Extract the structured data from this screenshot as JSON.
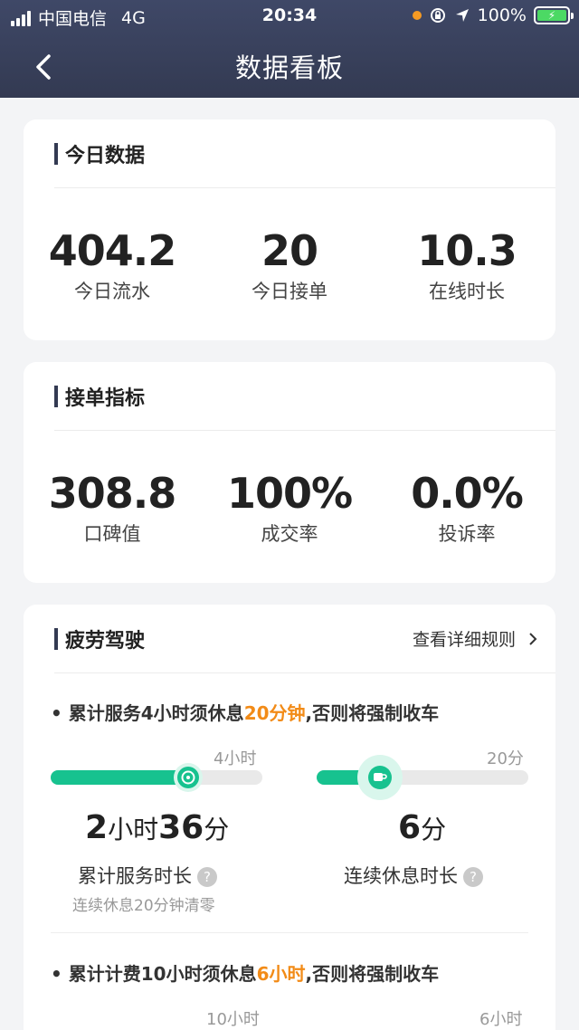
{
  "status_bar": {
    "carrier": "中国电信",
    "network": "4G",
    "time": "20:34",
    "battery": "100%",
    "accent_orange": "#f59a23",
    "battery_green": "#4cd964"
  },
  "nav": {
    "title": "数据看板",
    "back_icon": "chevron-left-icon"
  },
  "today": {
    "title": "今日数据",
    "stats": [
      {
        "value": "404.2",
        "label": "今日流水"
      },
      {
        "value": "20",
        "label": "今日接单"
      },
      {
        "value": "10.3",
        "label": "在线时长"
      }
    ]
  },
  "orders": {
    "title": "接单指标",
    "stats": [
      {
        "value": "308.8",
        "label": "口碑值"
      },
      {
        "value": "100%",
        "label": "成交率"
      },
      {
        "value": "0.0%",
        "label": "投诉率"
      }
    ]
  },
  "fatigue": {
    "title": "疲劳驾驶",
    "more_label": "查看详细规则",
    "rule1": {
      "bullet": "•",
      "prefix": "累计服务4小时须休息",
      "highlight": "20分钟",
      "suffix": ",否则将强制收车"
    },
    "service": {
      "max_label": "4小时",
      "progress": 0.65,
      "value_hours": "2",
      "unit_hours": "小时",
      "value_minutes": "36",
      "unit_minutes": "分",
      "label": "累计服务时长",
      "help": "?",
      "note": "连续休息20分钟清零"
    },
    "rest": {
      "max_label": "20分",
      "progress": 0.3,
      "value": "6",
      "unit": "分",
      "label": "连续休息时长",
      "help": "?"
    },
    "rule2": {
      "bullet": "•",
      "prefix": "累计计费10小时须休息",
      "highlight": "6小时",
      "suffix": ",否则将强制收车"
    },
    "charge": {
      "max_label": "10小时"
    },
    "rest2": {
      "max_label": "6小时"
    }
  },
  "colors": {
    "header": "#3a4260",
    "accent_green": "#17c28f",
    "highlight": "#f28b17"
  }
}
